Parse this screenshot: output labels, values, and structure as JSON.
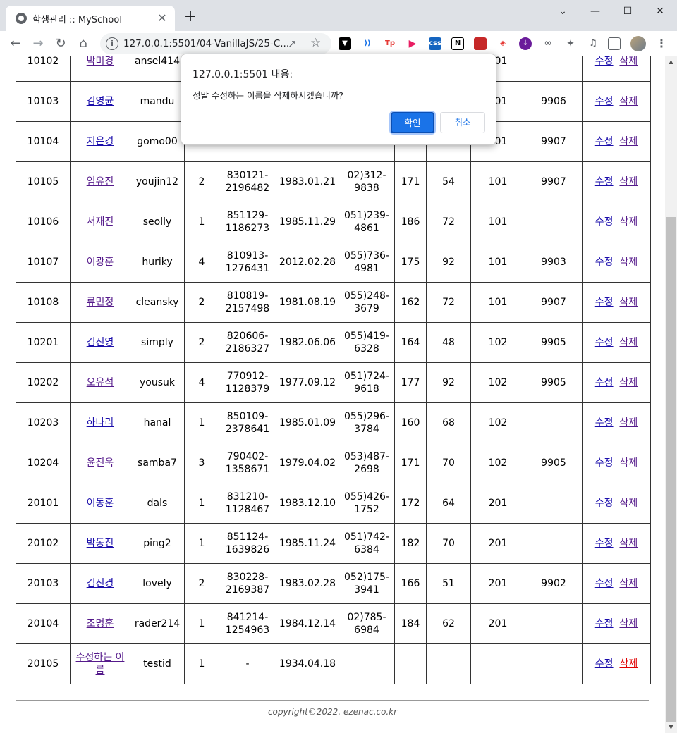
{
  "browser": {
    "tab_title": "학생관리 :: MySchool",
    "tab_close": "✕",
    "new_tab": "+",
    "minimize": "⌄",
    "url": "127.0.0.1:5501/04-VanillaJS/25-C...",
    "window_controls": [
      "—",
      "☐",
      "✕"
    ]
  },
  "dialog": {
    "title": "127.0.0.1:5501 내용:",
    "message": "정말 수정하는 이름을 삭제하시겠습니까?",
    "ok_label": "확인",
    "cancel_label": "취소"
  },
  "table": {
    "edit_label": "수정",
    "delete_label": "삭제",
    "rows": [
      {
        "no": "10102",
        "name": "박미경",
        "id": "ansel414",
        "grade": "",
        "jumin": "",
        "birth": "",
        "tel": "",
        "height": "",
        "weight": "",
        "dept": "101",
        "prof": "",
        "visited": true
      },
      {
        "no": "10103",
        "name": "김영균",
        "id": "mandu",
        "grade": "",
        "jumin": "",
        "birth": "",
        "tel": "",
        "height": "",
        "weight": "",
        "dept": "101",
        "prof": "9906",
        "visited": false
      },
      {
        "no": "10104",
        "name": "지은경",
        "id": "gomo00",
        "grade": "2",
        "jumin": "2298371",
        "birth": "1980.04.12",
        "tel": "9627",
        "height": "161",
        "weight": "42",
        "dept": "101",
        "prof": "9907",
        "visited": false
      },
      {
        "no": "10105",
        "name": "임유진",
        "id": "youjin12",
        "grade": "2",
        "jumin": "830121-2196482",
        "birth": "1983.01.21",
        "tel": "02)312-9838",
        "height": "171",
        "weight": "54",
        "dept": "101",
        "prof": "9907",
        "visited": true
      },
      {
        "no": "10106",
        "name": "서재진",
        "id": "seolly",
        "grade": "1",
        "jumin": "851129-1186273",
        "birth": "1985.11.29",
        "tel": "051)239-4861",
        "height": "186",
        "weight": "72",
        "dept": "101",
        "prof": "",
        "visited": true
      },
      {
        "no": "10107",
        "name": "이광훈",
        "id": "huriky",
        "grade": "4",
        "jumin": "810913-1276431",
        "birth": "2012.02.28",
        "tel": "055)736-4981",
        "height": "175",
        "weight": "92",
        "dept": "101",
        "prof": "9903",
        "visited": true
      },
      {
        "no": "10108",
        "name": "류민정",
        "id": "cleansky",
        "grade": "2",
        "jumin": "810819-2157498",
        "birth": "1981.08.19",
        "tel": "055)248-3679",
        "height": "162",
        "weight": "72",
        "dept": "101",
        "prof": "9907",
        "visited": true
      },
      {
        "no": "10201",
        "name": "김진영",
        "id": "simply",
        "grade": "2",
        "jumin": "820606-2186327",
        "birth": "1982.06.06",
        "tel": "055)419-6328",
        "height": "164",
        "weight": "48",
        "dept": "102",
        "prof": "9905",
        "visited": false
      },
      {
        "no": "10202",
        "name": "오유석",
        "id": "yousuk",
        "grade": "4",
        "jumin": "770912-1128379",
        "birth": "1977.09.12",
        "tel": "051)724-9618",
        "height": "177",
        "weight": "92",
        "dept": "102",
        "prof": "9905",
        "visited": true
      },
      {
        "no": "10203",
        "name": "하나리",
        "id": "hanal",
        "grade": "1",
        "jumin": "850109-2378641",
        "birth": "1985.01.09",
        "tel": "055)296-3784",
        "height": "160",
        "weight": "68",
        "dept": "102",
        "prof": "",
        "visited": false
      },
      {
        "no": "10204",
        "name": "윤진욱",
        "id": "samba7",
        "grade": "3",
        "jumin": "790402-1358671",
        "birth": "1979.04.02",
        "tel": "053)487-2698",
        "height": "171",
        "weight": "70",
        "dept": "102",
        "prof": "9905",
        "visited": true
      },
      {
        "no": "20101",
        "name": "이동훈",
        "id": "dals",
        "grade": "1",
        "jumin": "831210-1128467",
        "birth": "1983.12.10",
        "tel": "055)426-1752",
        "height": "172",
        "weight": "64",
        "dept": "201",
        "prof": "",
        "visited": false
      },
      {
        "no": "20102",
        "name": "박동진",
        "id": "ping2",
        "grade": "1",
        "jumin": "851124-1639826",
        "birth": "1985.11.24",
        "tel": "051)742-6384",
        "height": "182",
        "weight": "70",
        "dept": "201",
        "prof": "",
        "visited": false
      },
      {
        "no": "20103",
        "name": "김진경",
        "id": "lovely",
        "grade": "2",
        "jumin": "830228-2169387",
        "birth": "1983.02.28",
        "tel": "052)175-3941",
        "height": "166",
        "weight": "51",
        "dept": "201",
        "prof": "9902",
        "visited": false
      },
      {
        "no": "20104",
        "name": "조명훈",
        "id": "rader214",
        "grade": "1",
        "jumin": "841214-1254963",
        "birth": "1984.12.14",
        "tel": "02)785-6984",
        "height": "184",
        "weight": "62",
        "dept": "201",
        "prof": "",
        "visited": true
      },
      {
        "no": "20105",
        "name": "수정하는 이름",
        "id": "testid",
        "grade": "1",
        "jumin": "-",
        "birth": "1934.04.18",
        "tel": "",
        "height": "",
        "weight": "",
        "dept": "",
        "prof": "",
        "visited": true,
        "delete_active": true
      }
    ]
  },
  "footer": {
    "copyright": "copyright©2022. ezenac.co.kr"
  },
  "colors": {
    "link": "#1a0dab",
    "visited": "#551a8b",
    "active_delete": "#e00000",
    "dialog_ok": "#1a73e8"
  }
}
